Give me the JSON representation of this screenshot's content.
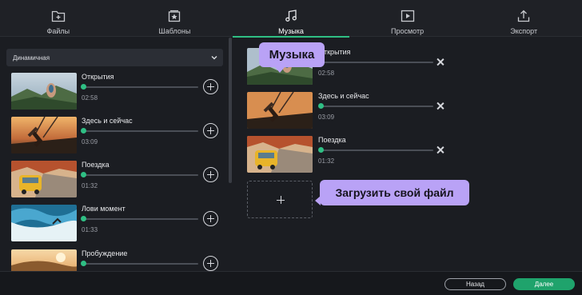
{
  "nav": {
    "tabs": [
      {
        "label": "Файлы",
        "icon": "files-icon"
      },
      {
        "label": "Шаблоны",
        "icon": "templates-icon"
      },
      {
        "label": "Музыка",
        "icon": "music-note-icon"
      },
      {
        "label": "Просмотр",
        "icon": "preview-play-icon"
      },
      {
        "label": "Экспорт",
        "icon": "export-icon"
      }
    ],
    "active_index": 2
  },
  "library": {
    "dropdown_value": "Динамичная",
    "tracks": [
      {
        "title": "Открытия",
        "duration": "02:58",
        "thumb": "mountain-hand"
      },
      {
        "title": "Здесь и сейчас",
        "duration": "03:09",
        "thumb": "swing-sunset"
      },
      {
        "title": "Поездка",
        "duration": "01:32",
        "thumb": "yellow-van"
      },
      {
        "title": "Лови момент",
        "duration": "01:33",
        "thumb": "surf-wave"
      },
      {
        "title": "Пробуждение",
        "duration": "",
        "thumb": "desert-sunrise"
      }
    ]
  },
  "selected": {
    "tracks": [
      {
        "title": "Открытия",
        "duration": "02:58",
        "thumb": "mountain-hand"
      },
      {
        "title": "Здесь и сейчас",
        "duration": "03:09",
        "thumb": "swing-sunset"
      },
      {
        "title": "Поездка",
        "duration": "01:32",
        "thumb": "yellow-van"
      }
    ]
  },
  "callouts": {
    "music": "Музыка",
    "upload": "Загрузить свой файл"
  },
  "footer": {
    "back_label": "Назад",
    "next_label": "Далее"
  },
  "colors": {
    "accent": "#2fbf84",
    "next_button": "#1fa36c",
    "callout": "#b9a2f6",
    "background": "#1b1d22"
  }
}
